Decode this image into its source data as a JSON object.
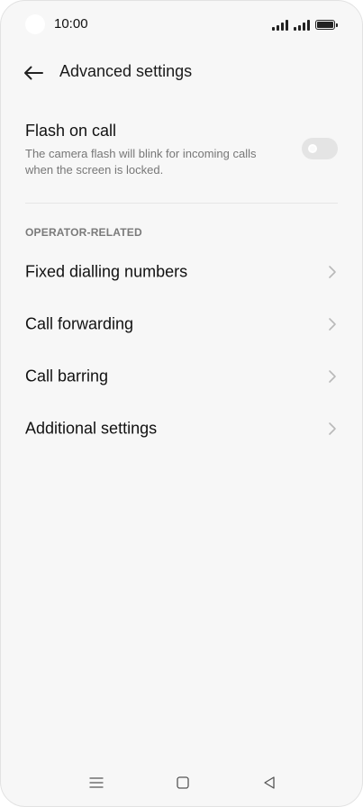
{
  "status_bar": {
    "time": "10:00",
    "icons": [
      "signal-icon",
      "signal-icon",
      "battery-icon"
    ]
  },
  "header": {
    "back_icon": "arrow-left-icon",
    "title": "Advanced settings"
  },
  "flash_on_call": {
    "title": "Flash on call",
    "description": "The camera flash will blink for incoming calls when the screen is locked.",
    "enabled": false
  },
  "section": {
    "header": "OPERATOR-RELATED"
  },
  "menu_items": [
    {
      "label": "Fixed dialling numbers",
      "icon": "chevron-right-icon"
    },
    {
      "label": "Call forwarding",
      "icon": "chevron-right-icon"
    },
    {
      "label": "Call barring",
      "icon": "chevron-right-icon"
    },
    {
      "label": "Additional settings",
      "icon": "chevron-right-icon"
    }
  ],
  "nav_bar": {
    "icons": [
      "menu-icon",
      "home-icon",
      "back-triangle-icon"
    ]
  },
  "colors": {
    "background": "#f7f7f7",
    "text_primary": "#111111",
    "text_secondary": "#777777",
    "section_header": "#7a7a7a",
    "toggle_off": "#e4e4e4"
  }
}
